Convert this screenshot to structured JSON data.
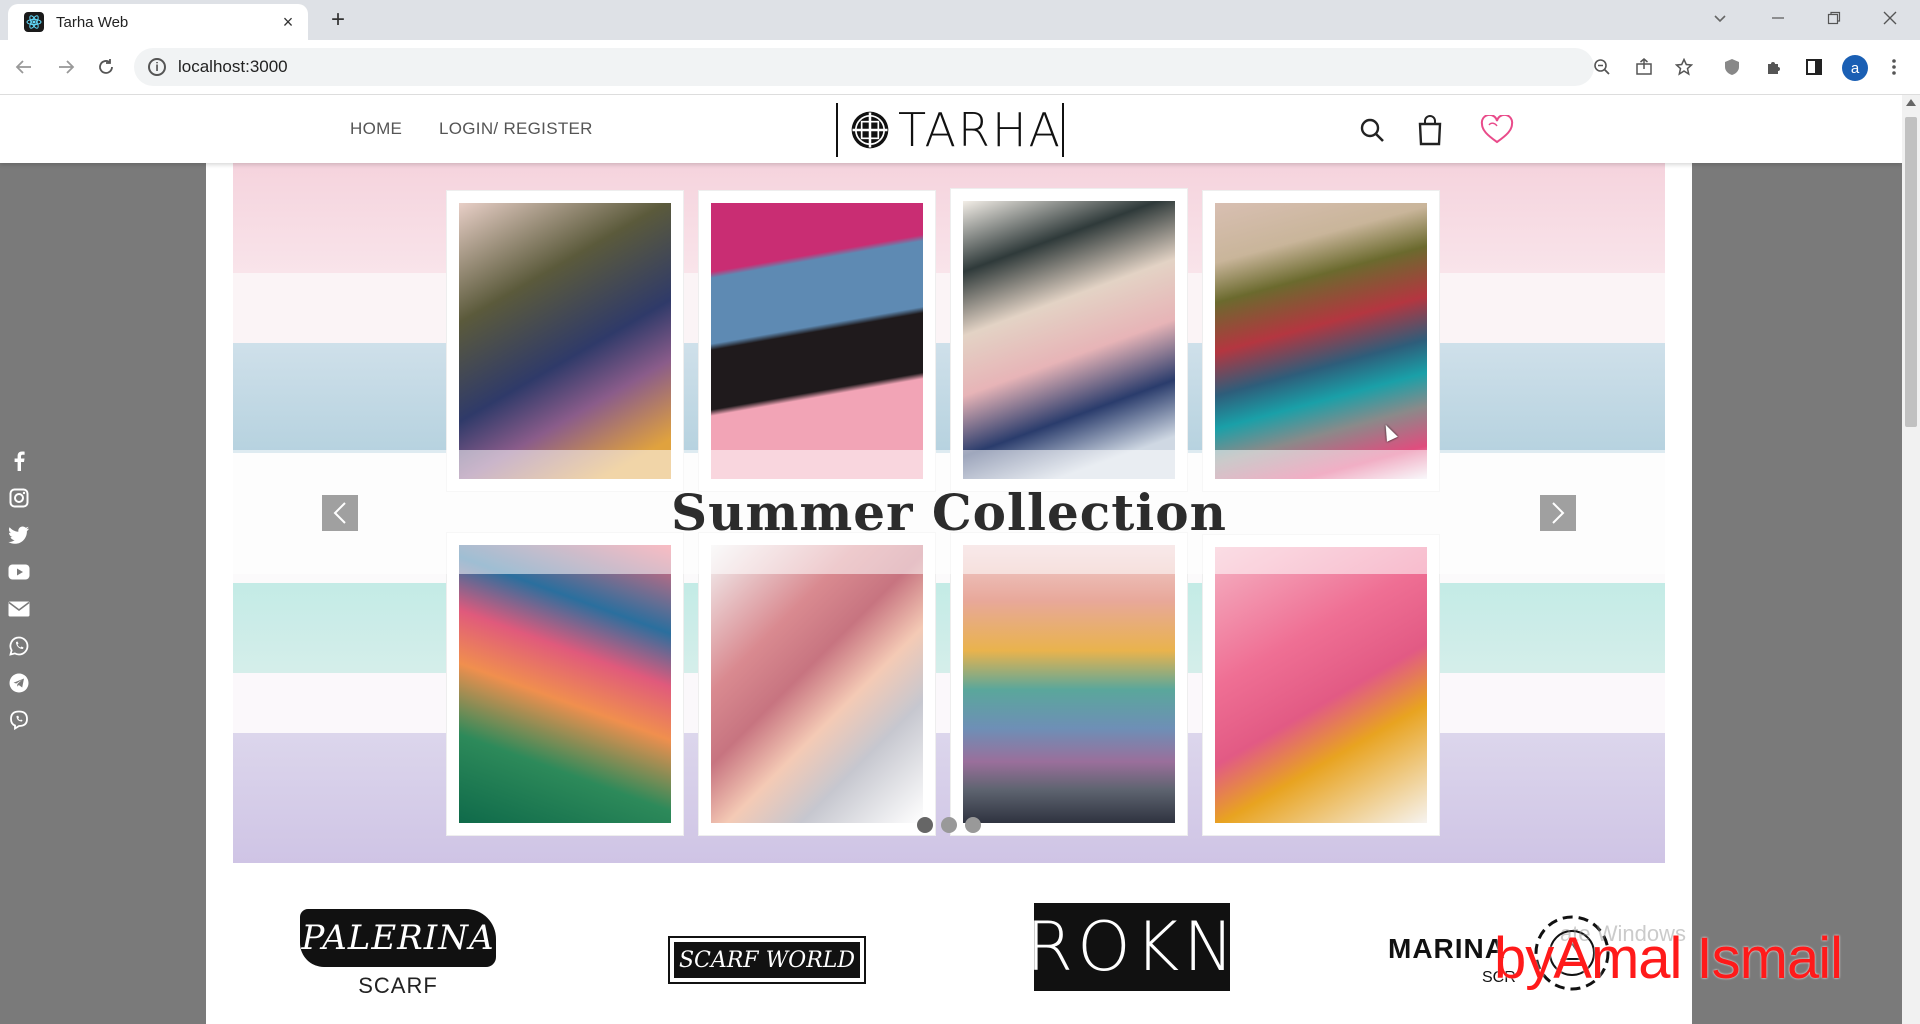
{
  "browser": {
    "tab_title": "Tarha Web",
    "tab_close": "×",
    "new_tab": "+",
    "url": "localhost:3000",
    "profile_initial": "a"
  },
  "header": {
    "menu": [
      "HOME",
      "LOGIN/ REGISTER"
    ],
    "logo_text": "TARHA"
  },
  "slider": {
    "caption": "Summer Collection",
    "dots": 3,
    "active_dot": 1
  },
  "brands": {
    "palerina": [
      "PALERINA",
      "SCARF"
    ],
    "scarf_world": "SCARF WORLD",
    "rokn": "ROKN",
    "marina": [
      "MARINA",
      "SCR",
      "MARINA"
    ]
  },
  "social_icons": [
    "facebook-icon",
    "instagram-icon",
    "twitter-icon",
    "youtube-icon",
    "mail-icon",
    "whatsapp-icon",
    "telegram-icon",
    "viber-icon"
  ],
  "overlay": {
    "windows_watermark": "ate Windows",
    "author": "byAmal Ismail"
  },
  "colors": {
    "heart": "#e94b8a",
    "author_text": "#ff1a1a",
    "page_bg": "#7a7a7a"
  }
}
